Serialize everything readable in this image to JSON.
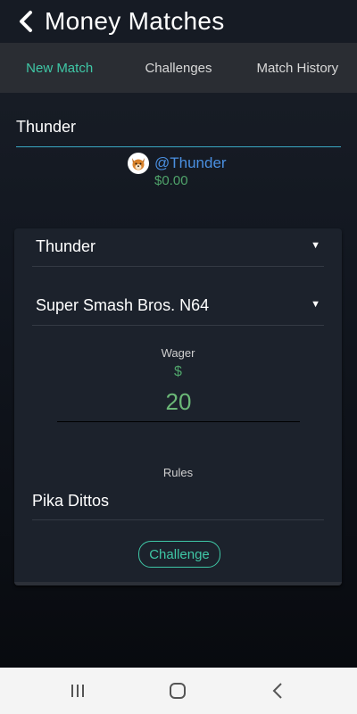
{
  "header": {
    "title": "Money Matches",
    "back_icon": "chevron-left-icon"
  },
  "tabs": [
    {
      "label": "New Match",
      "active": true
    },
    {
      "label": "Challenges",
      "active": false
    },
    {
      "label": "Match History",
      "active": false
    }
  ],
  "search": {
    "value": "Thunder"
  },
  "user": {
    "handle": "@Thunder",
    "balance": "$0.00",
    "avatar_icon": "fox-avatar-icon"
  },
  "form": {
    "opponent_select": {
      "value": "Thunder",
      "icon": "caret-down-icon"
    },
    "game_select": {
      "value": "Super Smash Bros. N64",
      "icon": "caret-down-icon"
    },
    "wager": {
      "label": "Wager",
      "currency": "$",
      "value": "20"
    },
    "rules": {
      "label": "Rules",
      "value": "Pika Dittos"
    },
    "submit_label": "Challenge"
  },
  "android_nav": {
    "recents_icon": "recents-icon",
    "home_icon": "home-icon",
    "back_icon": "back-icon"
  },
  "colors": {
    "accent": "#3fc7a6",
    "money": "#4fa36a",
    "link": "#4a8fe0"
  }
}
